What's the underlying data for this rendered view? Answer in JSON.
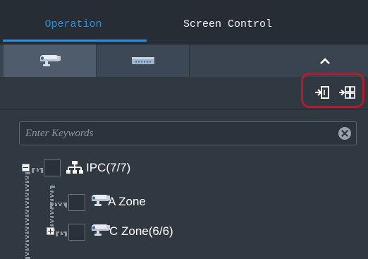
{
  "tabs": {
    "operation": "Operation",
    "screen_control": "Screen Control",
    "active": "operation"
  },
  "device_tabs": [
    {
      "icon": "camera-icon"
    },
    {
      "icon": "nvr-device-icon"
    }
  ],
  "toolbar": {
    "icons": [
      "import-to-window-icon",
      "import-to-grid-icon"
    ]
  },
  "search": {
    "placeholder": "Enter Keywords",
    "value": ""
  },
  "tree": [
    {
      "label": "IPC(7/7)",
      "icon": "network-icon",
      "expander": "expanded",
      "checked": false
    },
    {
      "label": "A Zone",
      "icon": "camera-icon",
      "expander": "none",
      "checked": false
    },
    {
      "label": "C Zone(6/6)",
      "icon": "camera-icon",
      "expander": "collapsed",
      "checked": false
    }
  ],
  "colors": {
    "accent": "#2f8fdc",
    "highlight": "#b01c2e",
    "panel": "#303842",
    "header": "#262d35"
  }
}
